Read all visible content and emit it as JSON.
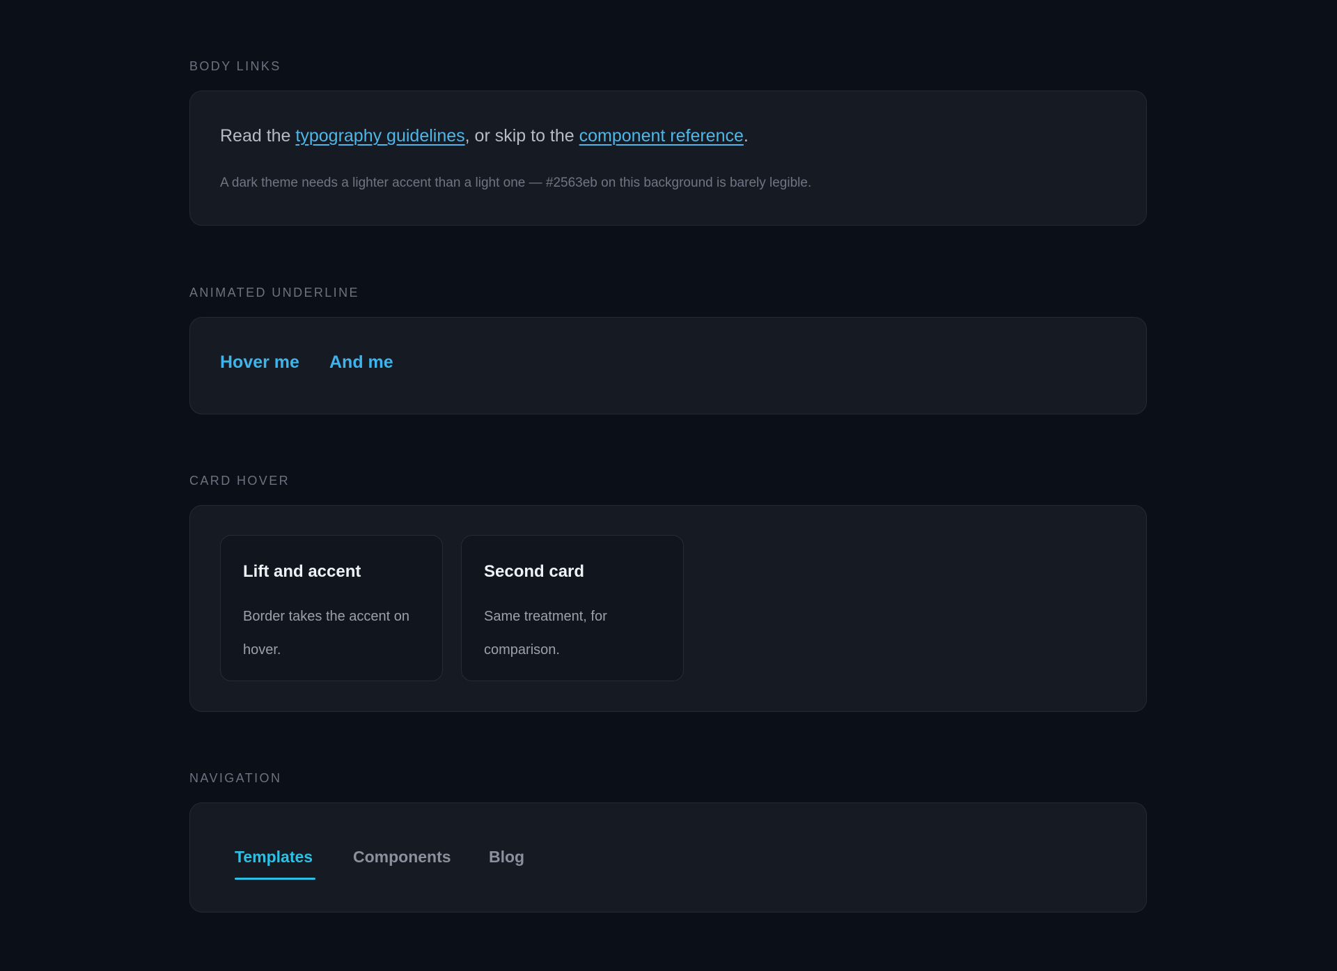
{
  "sections": {
    "body_links": {
      "label": "BODY LINKS",
      "lead_before": "Read the ",
      "link1": "typography guidelines",
      "lead_middle": ", or skip to the ",
      "link2": "component reference",
      "lead_after": ".",
      "note": "A dark theme needs a lighter accent than a light one — #2563eb on this background is barely legible."
    },
    "animated_underline": {
      "label": "ANIMATED UNDERLINE",
      "link1": "Hover me",
      "link2": "And me"
    },
    "card_hover": {
      "label": "CARD HOVER",
      "cards": [
        {
          "title": "Lift and accent",
          "body": "Border takes the accent on hover."
        },
        {
          "title": "Second card",
          "body": "Same treatment, for comparison."
        }
      ]
    },
    "navigation": {
      "label": "NAVIGATION",
      "items": [
        {
          "label": "Templates",
          "active": true
        },
        {
          "label": "Components",
          "active": false
        },
        {
          "label": "Blog",
          "active": false
        }
      ]
    }
  },
  "colors": {
    "background": "#0b0f17",
    "panel": "#161a23",
    "accent_link": "#4fb6e8",
    "accent_nav": "#2ec0e4"
  }
}
